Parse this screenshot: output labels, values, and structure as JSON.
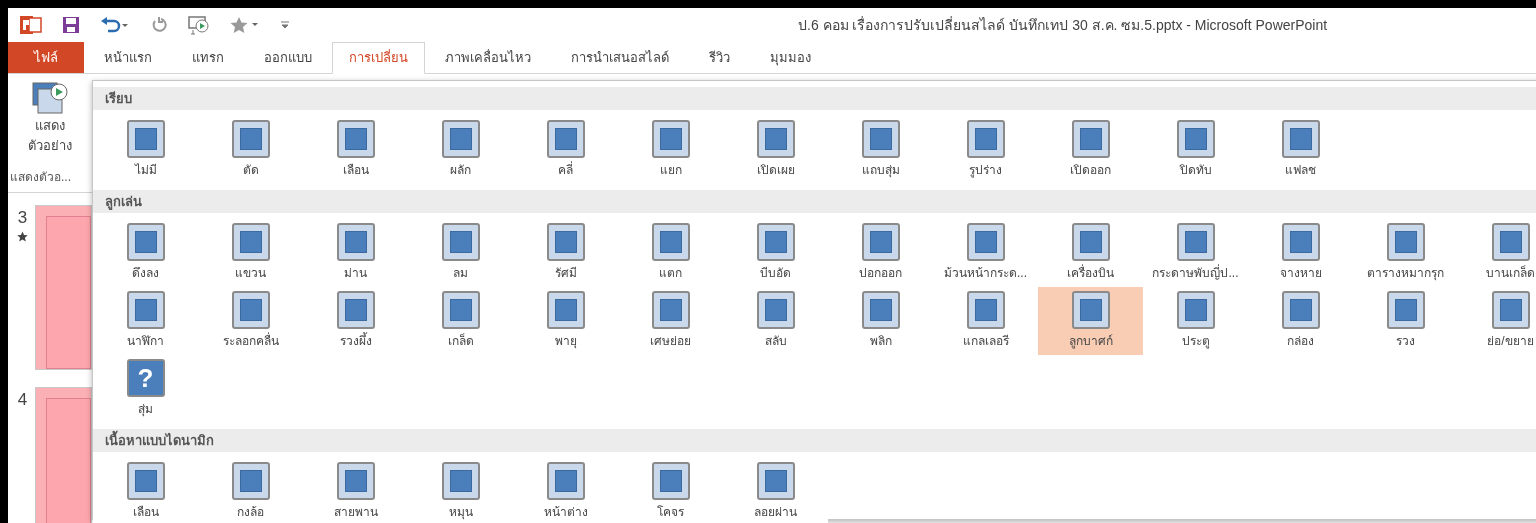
{
  "window": {
    "title": "ป.6 คอม เรื่องการปรับเปลี่ยนสไลด์ บันทึกเทป 30 ส.ค. ซม.5.pptx - Microsoft PowerPoint"
  },
  "tabs": [
    {
      "label": "ไฟล์",
      "kind": "file",
      "selected": false
    },
    {
      "label": "หน้าแรก",
      "kind": "tab",
      "selected": false
    },
    {
      "label": "แทรก",
      "kind": "tab",
      "selected": false
    },
    {
      "label": "ออกแบบ",
      "kind": "tab",
      "selected": false
    },
    {
      "label": "การเปลี่ยน",
      "kind": "tab",
      "selected": true
    },
    {
      "label": "ภาพเคลื่อนไหว",
      "kind": "tab",
      "selected": false
    },
    {
      "label": "การนำเสนอสไลด์",
      "kind": "tab",
      "selected": false
    },
    {
      "label": "รีวิว",
      "kind": "tab",
      "selected": false
    },
    {
      "label": "มุมมอง",
      "kind": "tab",
      "selected": false
    }
  ],
  "ribbon": {
    "preview_button": "แสดง ตัวอย่าง",
    "group_label": "แสดงตัวอ..."
  },
  "slides": [
    {
      "number": "3",
      "has_animation": true
    },
    {
      "number": "4",
      "has_animation": false
    }
  ],
  "gallery": {
    "sections": [
      {
        "title": "เรียบ",
        "items": [
          {
            "label": "ไม่มี",
            "selected": false
          },
          {
            "label": "ตัด",
            "selected": false
          },
          {
            "label": "เลือน",
            "selected": false
          },
          {
            "label": "ผลัก",
            "selected": false
          },
          {
            "label": "คลี่",
            "selected": false
          },
          {
            "label": "แยก",
            "selected": false
          },
          {
            "label": "เปิดเผย",
            "selected": false
          },
          {
            "label": "แถบสุ่ม",
            "selected": false
          },
          {
            "label": "รูปร่าง",
            "selected": false
          },
          {
            "label": "เปิดออก",
            "selected": false
          },
          {
            "label": "ปิดทับ",
            "selected": false
          },
          {
            "label": "แฟลช",
            "selected": false
          }
        ]
      },
      {
        "title": "ลูกเล่น",
        "items": [
          {
            "label": "ดึงลง",
            "selected": false
          },
          {
            "label": "แขวน",
            "selected": false
          },
          {
            "label": "ม่าน",
            "selected": false
          },
          {
            "label": "ลม",
            "selected": false
          },
          {
            "label": "รัศมี",
            "selected": false
          },
          {
            "label": "แตก",
            "selected": false
          },
          {
            "label": "บีบอัด",
            "selected": false
          },
          {
            "label": "ปอกออก",
            "selected": false
          },
          {
            "label": "ม้วนหน้ากระด...",
            "selected": false
          },
          {
            "label": "เครื่องบิน",
            "selected": false
          },
          {
            "label": "กระดาษพับญี่ป...",
            "selected": false
          },
          {
            "label": "จางหาย",
            "selected": false
          },
          {
            "label": "ตารางหมากรุก",
            "selected": false
          },
          {
            "label": "บานเกล็ด",
            "selected": false
          },
          {
            "label": "นาฬิกา",
            "selected": false
          },
          {
            "label": "ระลอกคลื่น",
            "selected": false
          },
          {
            "label": "รวงผึ้ง",
            "selected": false
          },
          {
            "label": "เกล็ด",
            "selected": false
          },
          {
            "label": "พายุ",
            "selected": false
          },
          {
            "label": "เศษย่อย",
            "selected": false
          },
          {
            "label": "สลับ",
            "selected": false
          },
          {
            "label": "พลิก",
            "selected": false
          },
          {
            "label": "แกลเลอรี",
            "selected": false
          },
          {
            "label": "ลูกบาศก์",
            "selected": true
          },
          {
            "label": "ประตู",
            "selected": false
          },
          {
            "label": "กล่อง",
            "selected": false
          },
          {
            "label": "รวง",
            "selected": false
          },
          {
            "label": "ย่อ/ขยาย",
            "selected": false
          },
          {
            "label": "สุ่ม",
            "selected": false,
            "glyph": "?"
          }
        ]
      },
      {
        "title": "เนื้อหาแบบไดนามิก",
        "items": [
          {
            "label": "เลือน",
            "selected": false
          },
          {
            "label": "กงล้อ",
            "selected": false
          },
          {
            "label": "สายพาน",
            "selected": false
          },
          {
            "label": "หมุน",
            "selected": false
          },
          {
            "label": "หน้าต่าง",
            "selected": false
          },
          {
            "label": "โคจร",
            "selected": false
          },
          {
            "label": "ลอยผ่าน",
            "selected": false
          }
        ]
      }
    ]
  }
}
